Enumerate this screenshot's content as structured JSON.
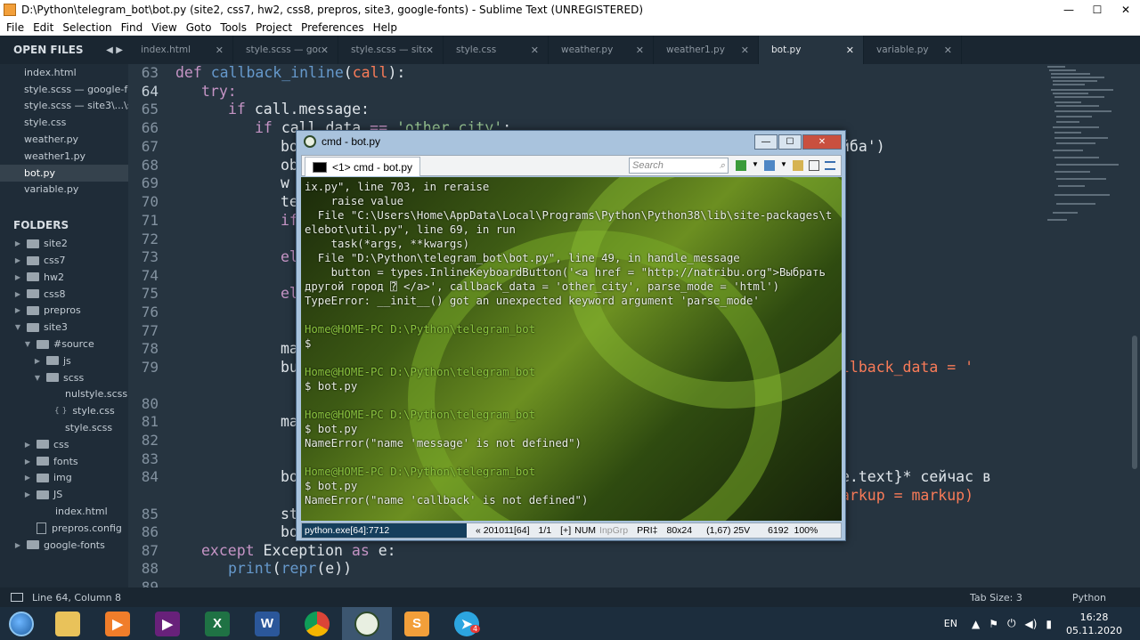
{
  "window": {
    "title": "D:\\Python\\telegram_bot\\bot.py (site2, css7, hw2, css8, prepros, site3, google-fonts) - Sublime Text (UNREGISTERED)",
    "minimize": "—",
    "maximize": "☐",
    "close": "✕"
  },
  "menu": [
    "File",
    "Edit",
    "Selection",
    "Find",
    "View",
    "Goto",
    "Tools",
    "Project",
    "Preferences",
    "Help"
  ],
  "sidebar": {
    "open_files_title": "OPEN FILES",
    "nav_arrows": "◀ ▶",
    "open_files": [
      "index.html",
      "style.scss — google-fonts\\...\\scss",
      "style.scss — site3\\...\\scss",
      "style.css",
      "weather.py",
      "weather1.py",
      "bot.py",
      "variable.py"
    ],
    "selected_file": "bot.py",
    "folders_title": "FOLDERS",
    "tree": [
      {
        "label": "site2",
        "type": "folder",
        "depth": 0,
        "arrow": "▶"
      },
      {
        "label": "css7",
        "type": "folder",
        "depth": 0,
        "arrow": "▶"
      },
      {
        "label": "hw2",
        "type": "folder",
        "depth": 0,
        "arrow": "▶"
      },
      {
        "label": "css8",
        "type": "folder",
        "depth": 0,
        "arrow": "▶"
      },
      {
        "label": "prepros",
        "type": "folder",
        "depth": 0,
        "arrow": "▶"
      },
      {
        "label": "site3",
        "type": "folder",
        "depth": 0,
        "arrow": "▼"
      },
      {
        "label": "#source",
        "type": "folder",
        "depth": 1,
        "arrow": "▼"
      },
      {
        "label": "js",
        "type": "folder",
        "depth": 2,
        "arrow": "▶"
      },
      {
        "label": "scss",
        "type": "folder",
        "depth": 2,
        "arrow": "▼"
      },
      {
        "label": "nulstyle.scss",
        "type": "plain",
        "depth": 3,
        "arrow": ""
      },
      {
        "label": "style.css",
        "type": "braces",
        "depth": 3,
        "arrow": ""
      },
      {
        "label": "style.scss",
        "type": "plain",
        "depth": 3,
        "arrow": ""
      },
      {
        "label": "css",
        "type": "folder",
        "depth": 1,
        "arrow": "▶"
      },
      {
        "label": "fonts",
        "type": "folder",
        "depth": 1,
        "arrow": "▶"
      },
      {
        "label": "img",
        "type": "folder",
        "depth": 1,
        "arrow": "▶"
      },
      {
        "label": "JS",
        "type": "folder",
        "depth": 1,
        "arrow": "▶"
      },
      {
        "label": "index.html",
        "type": "plain",
        "depth": 2,
        "arrow": ""
      },
      {
        "label": "prepros.config",
        "type": "file",
        "depth": 1,
        "arrow": ""
      },
      {
        "label": "google-fonts",
        "type": "folder",
        "depth": 0,
        "arrow": "▶"
      }
    ]
  },
  "tabs": [
    {
      "label": "index.html",
      "active": false
    },
    {
      "label": "style.scss — google-fonts\\...\\scss",
      "active": false
    },
    {
      "label": "style.scss — site3\\...\\scss",
      "active": false
    },
    {
      "label": "style.css",
      "active": false
    },
    {
      "label": "weather.py",
      "active": false
    },
    {
      "label": "weather1.py",
      "active": false
    },
    {
      "label": "bot.py",
      "active": true
    },
    {
      "label": "variable.py",
      "active": false
    }
  ],
  "tab_close_glyph": "✕",
  "editor": {
    "line_numbers": [
      "63",
      "64",
      "65",
      "66",
      "67",
      "68",
      "69",
      "70",
      "71",
      "72",
      "73",
      "74",
      "75",
      "76",
      "77",
      "78",
      "79",
      "80",
      "81",
      "82",
      "83",
      "84",
      "85",
      "86",
      "87",
      "88",
      "89"
    ],
    "visible_code": {
      "l63": "def callback_inline(call):",
      "l64": "try:",
      "l65": "if call.message:",
      "l66": "if call.data == 'other_city':",
      "l67a": "bo",
      "l67b": "йба')",
      "l68": "ob",
      "l69": "w",
      "l70": "te",
      "l71": "if",
      "l73": "el",
      "l75": "el",
      "l78": "ma",
      "l79a": "bu",
      "l79b": "llback_data = '",
      "l81": "ma",
      "l84a": "bo",
      "l84b": "e.text}* сейчас в",
      "l84c": "arkup = markup)",
      "l85": "st",
      "l86": "bo",
      "l87": "except Exception as e:",
      "l88": "print(repr(e))"
    }
  },
  "status_bar": {
    "position": "Line 64, Column 8",
    "tab_size": "Tab Size: 3",
    "syntax": "Python"
  },
  "cmd_window": {
    "title": "cmd - bot.py",
    "tab_label": "<1> cmd - bot.py",
    "search_placeholder": "Search",
    "console_lines": [
      {
        "text": "ix.py\", line 703, in reraise",
        "kind": "out"
      },
      {
        "text": "    raise value",
        "kind": "out"
      },
      {
        "text": "  File \"C:\\Users\\Home\\AppData\\Local\\Programs\\Python\\Python38\\lib\\site-packages\\t",
        "kind": "out"
      },
      {
        "text": "elebot\\util.py\", line 69, in run",
        "kind": "out"
      },
      {
        "text": "    task(*args, **kwargs)",
        "kind": "out"
      },
      {
        "text": "  File \"D:\\Python\\telegram_bot\\bot.py\", line 49, in handle_message",
        "kind": "out"
      },
      {
        "text": "    button = types.InlineKeyboardButton('<a href = \"http://natribu.org\">Выбрать",
        "kind": "out"
      },
      {
        "text": "другой город ⍰ </a>', callback_data = 'other_city', parse_mode = 'html')",
        "kind": "out"
      },
      {
        "text": "TypeError: __init__() got an unexpected keyword argument 'parse_mode'",
        "kind": "out"
      },
      {
        "text": "",
        "kind": "out"
      },
      {
        "text": "Home@HOME-PC D:\\Python\\telegram_bot",
        "kind": "prompt"
      },
      {
        "text": "$",
        "kind": "out"
      },
      {
        "text": "",
        "kind": "out"
      },
      {
        "text": "Home@HOME-PC D:\\Python\\telegram_bot",
        "kind": "prompt"
      },
      {
        "text": "$ bot.py",
        "kind": "out"
      },
      {
        "text": "",
        "kind": "out"
      },
      {
        "text": "Home@HOME-PC D:\\Python\\telegram_bot",
        "kind": "prompt"
      },
      {
        "text": "$ bot.py",
        "kind": "out"
      },
      {
        "text": "NameError(\"name 'message' is not defined\")",
        "kind": "out"
      },
      {
        "text": "",
        "kind": "out"
      },
      {
        "text": "Home@HOME-PC D:\\Python\\telegram_bot",
        "kind": "prompt"
      },
      {
        "text": "$ bot.py",
        "kind": "out"
      },
      {
        "text": "NameError(\"name 'callback' is not defined\")",
        "kind": "out"
      }
    ],
    "status": {
      "process": "python.exe[64]:7712",
      "info": "« 201011[64]",
      "page": "1/1",
      "mode": "[+]",
      "num": "NUM",
      "inpgrp": "InpGrp",
      "pri": "PRI‡",
      "size": "80x24",
      "cursor": "(1,67) 25V",
      "mem": "6192",
      "zoom": "100%"
    }
  },
  "taskbar": {
    "lang": "EN",
    "time": "16:28",
    "date": "05.11.2020",
    "telegram_badge": "4"
  },
  "colors": {
    "editor_bg": "#263440",
    "sidebar_bg": "#1f2c38",
    "keyword": "#c594c5",
    "function": "#6699cc",
    "string": "#99c794",
    "prompt": "#8cc63f"
  }
}
